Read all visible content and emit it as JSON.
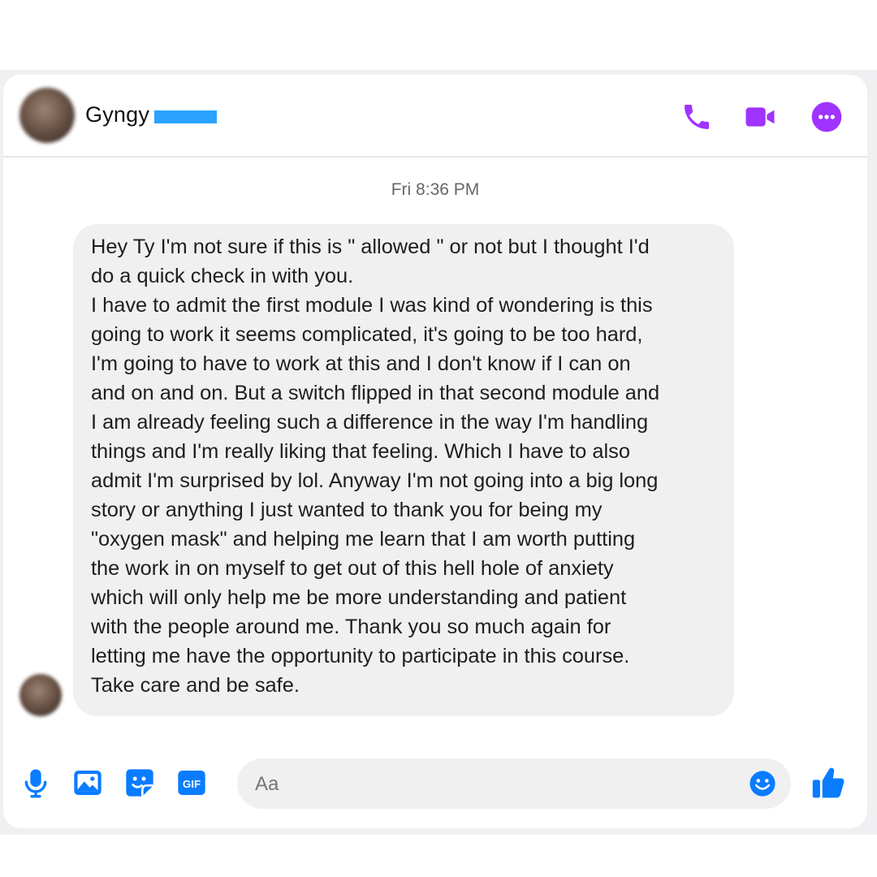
{
  "colors": {
    "accent_purple": "#a033ff",
    "accent_blue": "#0a7cff",
    "bubble_bg": "#f0f0f0",
    "redaction": "#2aa3ff"
  },
  "header": {
    "contact_name": "Gyngy",
    "icons": [
      "phone-icon",
      "video-camera-icon",
      "more-options-icon"
    ]
  },
  "conversation": {
    "timestamp": "Fri 8:36 PM",
    "message_lines": [
      "Hey Ty I'm not sure if this is \" allowed \" or not but I thought I'd",
      "do a quick check in with you.",
      "I have to admit the first module I was kind of wondering is this",
      "going to work it seems complicated, it's going to be too hard,",
      "I'm going to have to work at this and I don't know if I can on",
      "and on and on. But a switch flipped in that second module and",
      "I am already feeling such a difference in the way I'm handling",
      "things and I'm really liking that feeling. Which I have to also",
      "admit I'm surprised by lol. Anyway I'm not going into a big long",
      "story or anything I just wanted to thank you for being my",
      "\"oxygen mask\" and helping me learn that I am worth putting",
      "the work in on myself to get out of this hell hole of anxiety",
      "which will only help me be more understanding and patient",
      "with the people around me. Thank you so much again for",
      "letting me have the opportunity to participate in this course.",
      "Take care and be safe."
    ]
  },
  "composer": {
    "placeholder": "Aa",
    "gif_label": "GIF",
    "icons": [
      "microphone-icon",
      "photo-icon",
      "sticker-icon",
      "gif-icon",
      "emoji-icon",
      "thumbs-up-icon"
    ]
  }
}
